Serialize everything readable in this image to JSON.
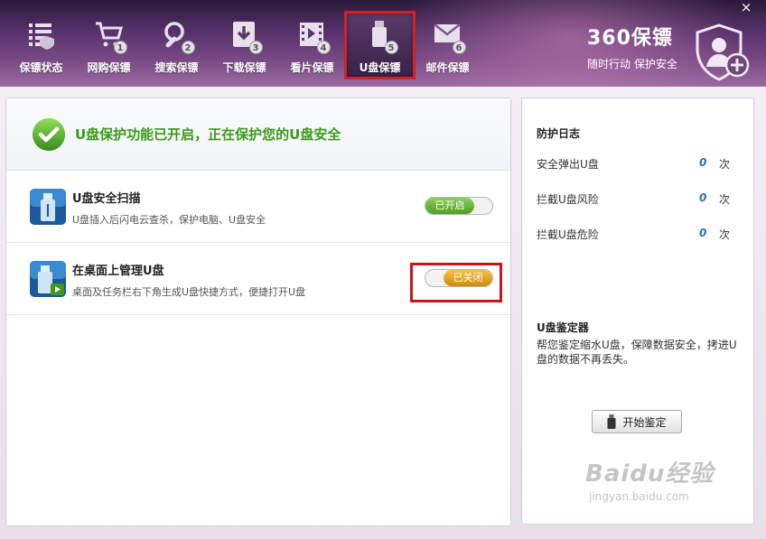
{
  "window": {
    "close_glyph": "×"
  },
  "tabs": [
    {
      "label": "保镖状态",
      "icon": "status-list-icon",
      "badge": ""
    },
    {
      "label": "网购保镖",
      "icon": "shopping-cart-icon",
      "badge": "1"
    },
    {
      "label": "搜索保镖",
      "icon": "search-icon",
      "badge": "2"
    },
    {
      "label": "下载保镖",
      "icon": "download-icon",
      "badge": "3"
    },
    {
      "label": "看片保镖",
      "icon": "video-icon",
      "badge": "4"
    },
    {
      "label": "U盘保镖",
      "icon": "usb-drive-icon",
      "badge": "5"
    },
    {
      "label": "邮件保镖",
      "icon": "mail-icon",
      "badge": "6"
    }
  ],
  "active_tab": 5,
  "brand": {
    "logo": "360保镖",
    "slogan": "随时行动  保护安全"
  },
  "status": {
    "text": "U盘保护功能已开启，正在保护您的U盘安全"
  },
  "features": [
    {
      "title": "U盘安全扫描",
      "desc": "U盘插入后闪电云查杀，保护电脑、U盘安全",
      "toggle_label": "已开启",
      "state": "on"
    },
    {
      "title": "在桌面上管理U盘",
      "desc": "桌面及任务栏右下角生成U盘快捷方式，便捷打开U盘",
      "toggle_label": "已关闭",
      "state": "off"
    }
  ],
  "log": {
    "title": "防护日志",
    "items": [
      {
        "label": "安全弹出U盘",
        "count": "0",
        "unit": "次"
      },
      {
        "label": "拦截U盘风险",
        "count": "0",
        "unit": "次"
      },
      {
        "label": "拦截U盘危险",
        "count": "0",
        "unit": "次"
      }
    ]
  },
  "identifier": {
    "title": "U盘鉴定器",
    "desc": "帮您鉴定缩水U盘，保障数据安全，拷进U盘的数据不再丢失。",
    "button_label": "开始鉴定"
  },
  "watermark": {
    "main": "Baidu经验",
    "sub": "jingyan.baidu.com"
  },
  "colors": {
    "accent_green": "#3a9a1a",
    "highlight_red": "#c4161c",
    "header_purple": "#55306a",
    "count_blue": "#1a72c8"
  }
}
